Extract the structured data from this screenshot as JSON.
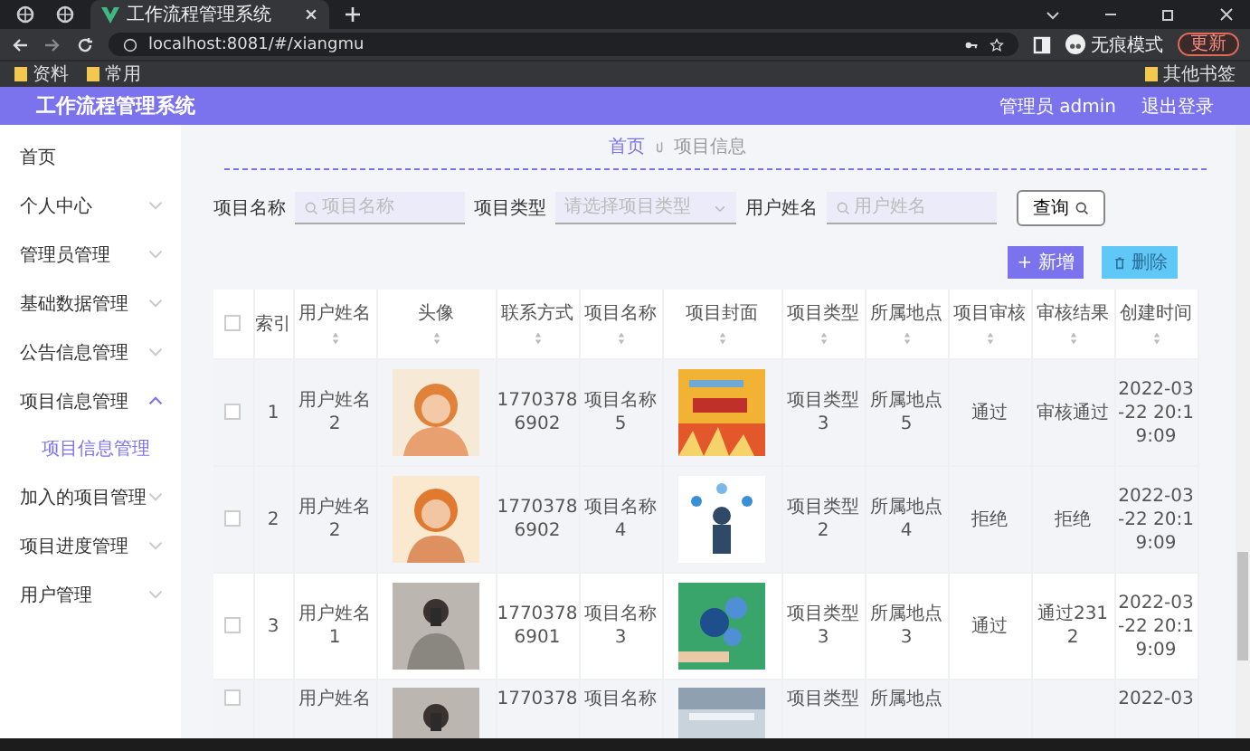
{
  "browser": {
    "tabs": [
      {
        "selected": false
      },
      {
        "selected": false
      },
      {
        "title": "工作流程管理系统",
        "selected": true
      }
    ],
    "address": "localhost:8081/#/xiangmu",
    "profile": "无痕模式",
    "update": "更新",
    "bookmarks": [
      "资料",
      "常用"
    ],
    "other_bookmarks": "其他书签"
  },
  "header": {
    "title": "工作流程管理系统",
    "user": "管理员 admin",
    "logout": "退出登录"
  },
  "sidebar": {
    "items": [
      {
        "label": "首页",
        "kind": "link"
      },
      {
        "label": "个人中心",
        "kind": "menu",
        "expanded": false
      },
      {
        "label": "管理员管理",
        "kind": "menu",
        "expanded": false
      },
      {
        "label": "基础数据管理",
        "kind": "menu",
        "expanded": false
      },
      {
        "label": "公告信息管理",
        "kind": "menu",
        "expanded": false
      },
      {
        "label": "项目信息管理",
        "kind": "menu",
        "expanded": true,
        "children": [
          {
            "label": "项目信息管理",
            "selected": true
          }
        ]
      },
      {
        "label": "加入的项目管理",
        "kind": "menu",
        "expanded": false
      },
      {
        "label": "项目进度管理",
        "kind": "menu",
        "expanded": false
      },
      {
        "label": "用户管理",
        "kind": "menu",
        "expanded": false
      }
    ]
  },
  "breadcrumb": [
    "首页",
    "项目信息"
  ],
  "search": {
    "fields": [
      {
        "label": "项目名称",
        "placeholder": "项目名称",
        "kind": "input"
      },
      {
        "label": "项目类型",
        "placeholder": "请选择项目类型",
        "kind": "select"
      },
      {
        "label": "用户姓名",
        "placeholder": "用户姓名",
        "kind": "input"
      }
    ],
    "query_button": "查询"
  },
  "actions": {
    "add": "+ 新增",
    "delete": "删除"
  },
  "table": {
    "select_all_checked": false,
    "columns": [
      {
        "label": "索引",
        "sortable": false
      },
      {
        "label": "用户姓名",
        "sortable": true
      },
      {
        "label": "头像",
        "sortable": true
      },
      {
        "label": "联系方式",
        "sortable": true
      },
      {
        "label": "项目名称",
        "sortable": true
      },
      {
        "label": "项目封面",
        "sortable": true
      },
      {
        "label": "项目类型",
        "sortable": true
      },
      {
        "label": "所属地点",
        "sortable": true
      },
      {
        "label": "项目审核",
        "sortable": true
      },
      {
        "label": "审核结果",
        "sortable": true
      },
      {
        "label": "创建时间",
        "sortable": true
      }
    ],
    "rows": [
      {
        "checked": false,
        "highlighted": true,
        "cells": [
          {
            "kind": "text",
            "text": "1"
          },
          {
            "kind": "text",
            "text": "用户姓名2"
          },
          {
            "kind": "picture"
          },
          {
            "kind": "text",
            "text": "17703786902"
          },
          {
            "kind": "text",
            "text": "项目名称5"
          },
          {
            "kind": "picture"
          },
          {
            "kind": "text",
            "text": "项目类型3"
          },
          {
            "kind": "text",
            "text": "所属地点5"
          },
          {
            "kind": "text",
            "text": "通过"
          },
          {
            "kind": "text",
            "text": "审核通过"
          },
          {
            "kind": "text",
            "text": "2022-03-22 20:19:09"
          }
        ]
      },
      {
        "checked": false,
        "highlighted": true,
        "cells": [
          {
            "kind": "text",
            "text": "2"
          },
          {
            "kind": "text",
            "text": "用户姓名2"
          },
          {
            "kind": "picture"
          },
          {
            "kind": "text",
            "text": "17703786902"
          },
          {
            "kind": "text",
            "text": "项目名称4"
          },
          {
            "kind": "picture"
          },
          {
            "kind": "text",
            "text": "项目类型2"
          },
          {
            "kind": "text",
            "text": "所属地点4"
          },
          {
            "kind": "text",
            "text": "拒绝"
          },
          {
            "kind": "text",
            "text": "拒绝"
          },
          {
            "kind": "text",
            "text": "2022-03-22 20:19:09"
          }
        ]
      },
      {
        "checked": false,
        "highlighted": false,
        "cells": [
          {
            "kind": "text",
            "text": "3"
          },
          {
            "kind": "text",
            "text": "用户姓名1"
          },
          {
            "kind": "picture"
          },
          {
            "kind": "text",
            "text": "17703786901"
          },
          {
            "kind": "text",
            "text": "项目名称3"
          },
          {
            "kind": "picture"
          },
          {
            "kind": "text",
            "text": "项目类型3"
          },
          {
            "kind": "text",
            "text": "所属地点3"
          },
          {
            "kind": "text",
            "text": "通过"
          },
          {
            "kind": "text",
            "text": "通过2312"
          },
          {
            "kind": "text",
            "text": "2022-03-22 20:19:09"
          }
        ]
      },
      {
        "checked": false,
        "highlighted": true,
        "cells": [
          {
            "kind": "empty"
          },
          {
            "kind": "text",
            "text": "用户姓名"
          },
          {
            "kind": "picture"
          },
          {
            "kind": "text",
            "text": "1770378"
          },
          {
            "kind": "text",
            "text": "项目名称"
          },
          {
            "kind": "picture"
          },
          {
            "kind": "text",
            "text": "项目类型"
          },
          {
            "kind": "text",
            "text": "所属地点"
          },
          {
            "kind": "empty"
          },
          {
            "kind": "empty"
          },
          {
            "kind": "text",
            "text": "2022-03"
          }
        ]
      }
    ]
  }
}
